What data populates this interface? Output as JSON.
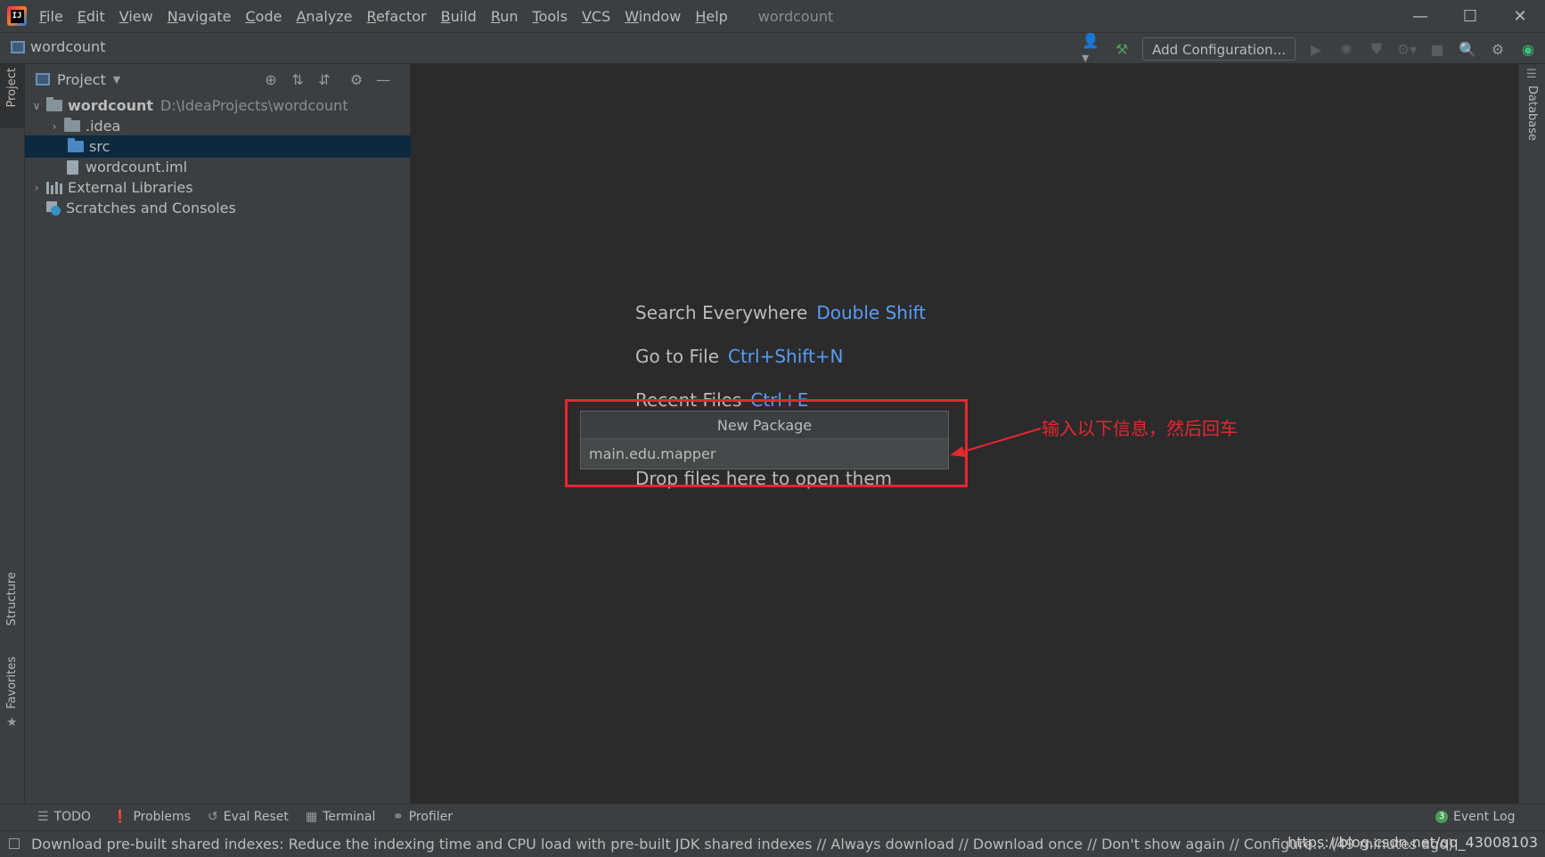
{
  "menubar": {
    "items": [
      "File",
      "Edit",
      "View",
      "Navigate",
      "Code",
      "Analyze",
      "Refactor",
      "Build",
      "Run",
      "Tools",
      "VCS",
      "Window",
      "Help"
    ],
    "window_title": "wordcount",
    "logo_text": "IJ",
    "minimize_icon": "minimize-icon",
    "maximize_icon": "maximize-icon",
    "close_icon": "close-icon"
  },
  "navbar": {
    "breadcrumb": "wordcount",
    "add_configuration": "Add Configuration..."
  },
  "project_panel": {
    "title": "Project",
    "tree": [
      {
        "label": "wordcount",
        "path": "D:\\IdeaProjects\\wordcount",
        "type": "project",
        "expanded": true,
        "indent": 0
      },
      {
        "label": ".idea",
        "type": "folder",
        "expanded": false,
        "indent": 1
      },
      {
        "label": "src",
        "type": "source-folder",
        "selected": true,
        "indent": 1
      },
      {
        "label": "wordcount.iml",
        "type": "file",
        "indent": 1
      },
      {
        "label": "External Libraries",
        "type": "libraries",
        "expanded": false,
        "indent": 0
      },
      {
        "label": "Scratches and Consoles",
        "type": "scratches",
        "indent": 0
      }
    ]
  },
  "left_strip": {
    "project_tab": "Project",
    "structure_tab": "Structure",
    "favorites_tab": "Favorites"
  },
  "right_strip": {
    "database_tab": "Database"
  },
  "editor": {
    "hints": [
      {
        "label": "Search Everywhere",
        "shortcut": "Double Shift"
      },
      {
        "label": "Go to File",
        "shortcut": "Ctrl+Shift+N"
      },
      {
        "label": "Recent Files",
        "shortcut": "Ctrl+E"
      }
    ],
    "drop_hint": "Drop files here to open them"
  },
  "dialog": {
    "title": "New Package",
    "input_value": "main.edu.mapper"
  },
  "annotation": {
    "text": "输入以下信息，然后回车",
    "color": "#e8262f"
  },
  "bottom_tools": {
    "todo": "TODO",
    "problems": "Problems",
    "eval_reset": "Eval Reset",
    "terminal": "Terminal",
    "profiler": "Profiler",
    "event_log": "Event Log",
    "event_count": "3"
  },
  "status": {
    "message": "Download pre-built shared indexes: Reduce the indexing time and CPU load with pre-built JDK shared indexes // Always download // Download once // Don't show again // Configure... (49 minutes ago)",
    "watermark": "https://blog.csdn.net/qq_43008103"
  },
  "colors": {
    "background": "#2b2b2b",
    "panel": "#3c3f41",
    "selection": "#0d293e",
    "shortcut_blue": "#589df6",
    "annotation_red": "#e8262f"
  }
}
